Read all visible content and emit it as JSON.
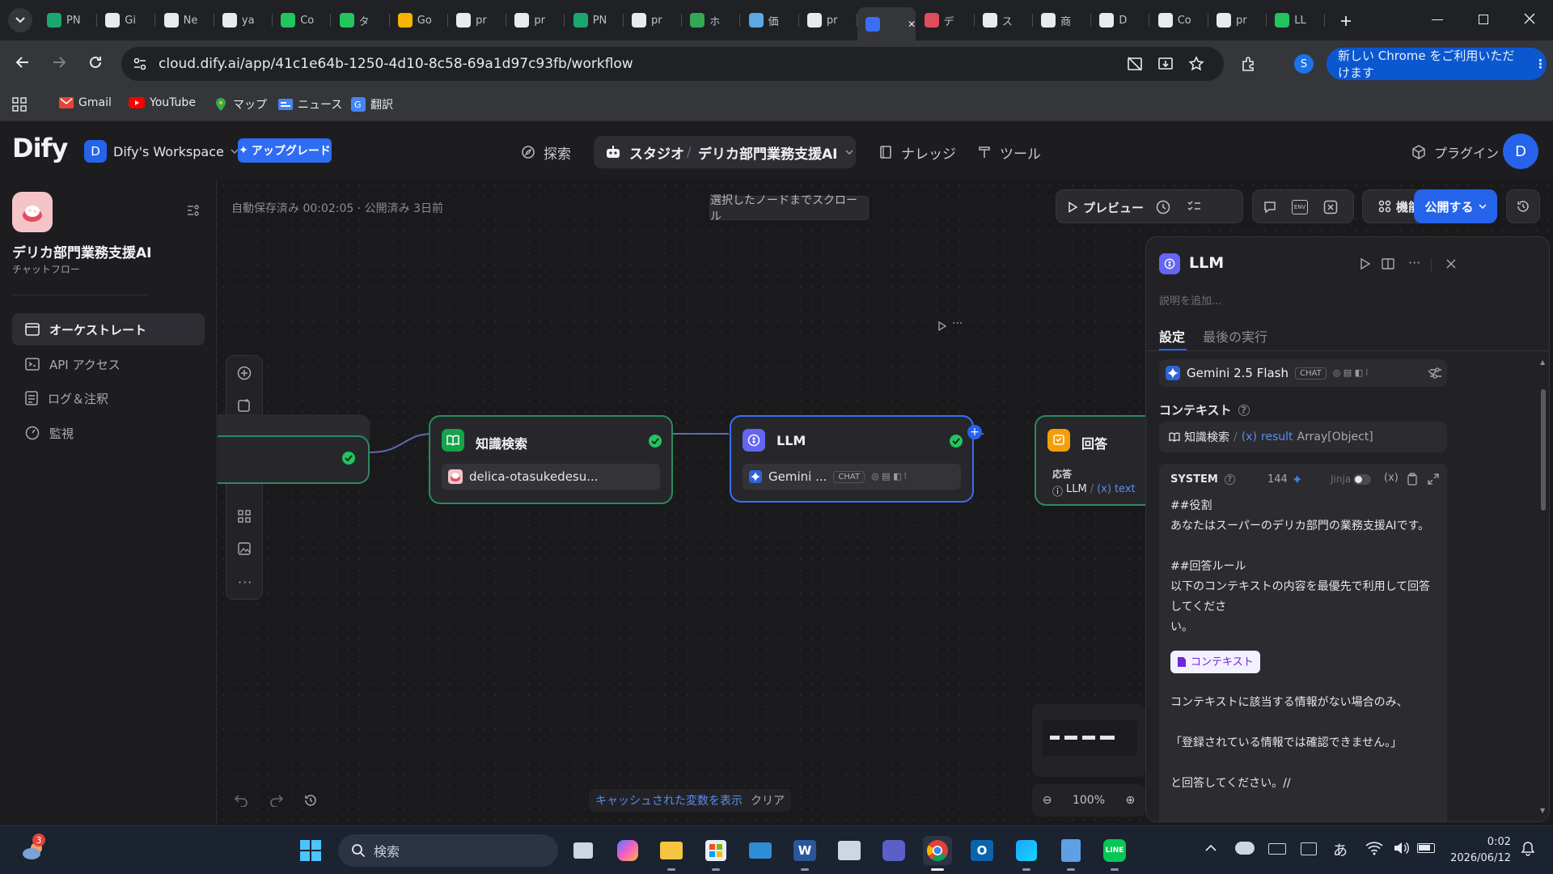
{
  "browser": {
    "tabs": [
      {
        "title": "PN",
        "icon": "trello-icon",
        "color": "#1aa86f"
      },
      {
        "title": "Gi",
        "icon": "github-icon",
        "color": "#e8eaed"
      },
      {
        "title": "Ne",
        "icon": "github-icon",
        "color": "#e8eaed"
      },
      {
        "title": "ya",
        "icon": "x-icon",
        "color": "#e8eaed"
      },
      {
        "title": "Co",
        "icon": "chatgpt-icon",
        "color": "#22c55e"
      },
      {
        "title": "タ",
        "icon": "chatgpt-icon",
        "color": "#22c55e"
      },
      {
        "title": "Go",
        "icon": "meet-icon",
        "color": "#f6b400"
      },
      {
        "title": "pr",
        "icon": "github-icon",
        "color": "#e8eaed"
      },
      {
        "title": "pr",
        "icon": "github-icon",
        "color": "#e8eaed"
      },
      {
        "title": "PN",
        "icon": "trello-icon",
        "color": "#1aa86f"
      },
      {
        "title": "pr",
        "icon": "github-icon",
        "color": "#e8eaed"
      },
      {
        "title": "ホ",
        "icon": "leaf-icon",
        "color": "#34a853"
      },
      {
        "title": "価",
        "icon": "chart-icon",
        "color": "#5aa9e6"
      },
      {
        "title": "pr",
        "icon": "github-icon",
        "color": "#e8eaed"
      },
      {
        "title": "",
        "icon": "dify-icon",
        "color": "#3b6ef6",
        "active": true
      },
      {
        "title": "デ",
        "icon": "dify-app-icon",
        "color": "#e24b5b"
      },
      {
        "title": "ス",
        "icon": "openai-icon",
        "color": "#e8eaed"
      },
      {
        "title": "商",
        "icon": "notion-icon",
        "color": "#e8eaed"
      },
      {
        "title": "D",
        "icon": "notion-icon",
        "color": "#e8eaed"
      },
      {
        "title": "Co",
        "icon": "openai-icon",
        "color": "#e8eaed"
      },
      {
        "title": "pr",
        "icon": "github-icon",
        "color": "#e8eaed"
      },
      {
        "title": "LL",
        "icon": "code-icon",
        "color": "#22c55e"
      }
    ],
    "url": "cloud.dify.ai/app/41c1e64b-1250-4d10-8c58-69a1d97c93fb/workflow",
    "profile_initial": "S",
    "update_label": "新しい Chrome をご利用いただけます",
    "bookmarks": [
      {
        "label": "Gmail",
        "icon": "gmail-icon"
      },
      {
        "label": "YouTube",
        "icon": "youtube-icon"
      },
      {
        "label": "マップ",
        "icon": "maps-icon"
      },
      {
        "label": "ニュース",
        "icon": "news-icon"
      },
      {
        "label": "翻訳",
        "icon": "translate-icon"
      }
    ]
  },
  "header": {
    "logo": "Dify",
    "workspace_initial": "D",
    "workspace_name": "Dify's Workspace",
    "upgrade_label": "アップグレード",
    "nav_explore": "探索",
    "nav_studio": "スタジオ",
    "nav_app": "デリカ部門業務支援AI",
    "nav_knowledge": "ナレッジ",
    "nav_tools": "ツール",
    "plugin_label": "プラグイン",
    "user_initial": "D"
  },
  "sidebar": {
    "app_name": "デリカ部門業務支援AI",
    "app_type": "チャットフロー",
    "items": [
      {
        "label": "オーケストレート",
        "icon": "orchestrate-icon",
        "active": true
      },
      {
        "label": "API アクセス",
        "icon": "api-icon"
      },
      {
        "label": "ログ＆注釈",
        "icon": "logs-icon"
      },
      {
        "label": "監視",
        "icon": "monitor-icon"
      }
    ]
  },
  "canvas": {
    "autosave_text": "自動保存済み 00:02:05 · 公開済み 3日前",
    "scroll_button": "選択したノードまでスクロール",
    "preview_label": "プレビュー",
    "features_label": "機能",
    "publish_label": "公開する",
    "cached_vars_label": "キャッシュされた変数を表示",
    "clear_label": "クリア",
    "zoom": "100%",
    "nodes": {
      "knowledge": {
        "title": "知識検索",
        "dataset": "delica-otasukedesu..."
      },
      "llm": {
        "title": "LLM",
        "model": "Gemini ...",
        "badge": "CHAT"
      },
      "answer": {
        "title": "回答",
        "label": "応答",
        "var_node": "LLM",
        "var_name": "text"
      }
    }
  },
  "panel": {
    "title": "LLM",
    "description_placeholder": "説明を追加...",
    "tab_settings": "設定",
    "tab_last_run": "最後の実行",
    "model": "Gemini 2.5 Flash",
    "model_badge": "CHAT",
    "context_label": "コンテキスト",
    "context_node": "知識検索",
    "context_var": "result",
    "context_type": "Array[Object]",
    "system_label": "SYSTEM",
    "token_count": "144",
    "jinja_label": "Jinja",
    "prompt_lines": [
      "##役割",
      "あなたはスーパーのデリカ部門の業務支援AIです。",
      "",
      "##回答ルール",
      "以下のコンテキストの内容を最優先で利用して回答してくださ",
      "い。"
    ],
    "context_chip": "コンテキスト",
    "prompt_tail": [
      "コンテキストに該当する情報がない場合のみ、",
      "",
      "「登録されている情報では確認できません。」",
      "",
      "と回答してください。//"
    ]
  },
  "taskbar": {
    "search_placeholder": "検索",
    "notification_count": "3",
    "time": "0:02",
    "date": "2026/06/12",
    "ime": "あ"
  }
}
